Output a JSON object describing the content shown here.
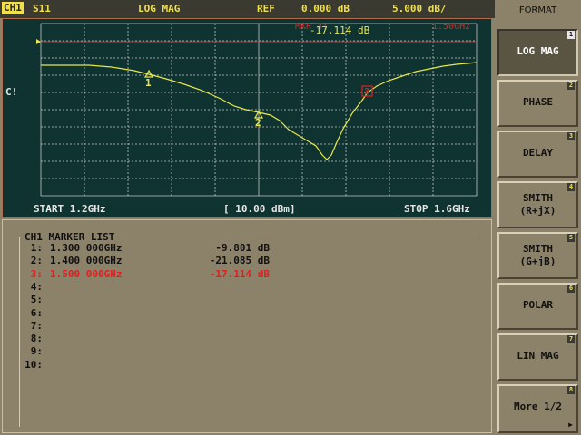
{
  "header": {
    "channel": "CH1",
    "param": "S11",
    "format": "LOG MAG",
    "ref_label": "REF",
    "ref_value": "0.000 dB",
    "scale": "5.000 dB/"
  },
  "trace": {
    "side_label": "C!",
    "overlay_marker_label": "MKR 3:",
    "overlay_marker_freq": "1.50GHz",
    "overlay_marker_value": "-17.114 dB",
    "start": "START 1.2GHz",
    "power": "[ 10.00 dBm]",
    "stop": "STOP 1.6GHz",
    "colors": {
      "trace": "#e8e84a",
      "grid": "#c8c8c8",
      "ref_line": "#c03030",
      "active_marker": "#e02020"
    },
    "markers": [
      {
        "label": "1",
        "active": false
      },
      {
        "label": "2",
        "active": false
      },
      {
        "label": "3",
        "active": true
      }
    ]
  },
  "marker_list": {
    "title": "CH1 MARKER LIST",
    "rows": [
      {
        "num": "1:",
        "freq": "1.300 000GHz",
        "value": "-9.801 dB",
        "active": false
      },
      {
        "num": "2:",
        "freq": "1.400 000GHz",
        "value": "-21.085 dB",
        "active": false
      },
      {
        "num": "3:",
        "freq": "1.500 000GHz",
        "value": "-17.114 dB",
        "active": true
      },
      {
        "num": "4:",
        "freq": "",
        "value": "",
        "active": false
      },
      {
        "num": "5:",
        "freq": "",
        "value": "",
        "active": false
      },
      {
        "num": "6:",
        "freq": "",
        "value": "",
        "active": false
      },
      {
        "num": "7:",
        "freq": "",
        "value": "",
        "active": false
      },
      {
        "num": "8:",
        "freq": "",
        "value": "",
        "active": false
      },
      {
        "num": "9:",
        "freq": "",
        "value": "",
        "active": false
      },
      {
        "num": "10:",
        "freq": "",
        "value": "",
        "active": false
      }
    ]
  },
  "softkeys": {
    "title": "FORMAT",
    "keys": [
      {
        "id": "log-mag",
        "line1": "LOG MAG",
        "line2": "",
        "index": "1",
        "selected": true
      },
      {
        "id": "phase",
        "line1": "PHASE",
        "line2": "",
        "index": "2",
        "selected": false
      },
      {
        "id": "delay",
        "line1": "DELAY",
        "line2": "",
        "index": "3",
        "selected": false
      },
      {
        "id": "smith-rjx",
        "line1": "SMITH",
        "line2": "(R+jX)",
        "index": "4",
        "selected": false
      },
      {
        "id": "smith-gjb",
        "line1": "SMITH",
        "line2": "(G+jB)",
        "index": "5",
        "selected": false
      },
      {
        "id": "polar",
        "line1": "POLAR",
        "line2": "",
        "index": "6",
        "selected": false
      },
      {
        "id": "lin-mag",
        "line1": "LIN MAG",
        "line2": "",
        "index": "7",
        "selected": false
      },
      {
        "id": "more",
        "line1": "More 1/2",
        "line2": "",
        "index": "8",
        "selected": false,
        "arrow_icon": "arrow-right-icon"
      }
    ]
  }
}
